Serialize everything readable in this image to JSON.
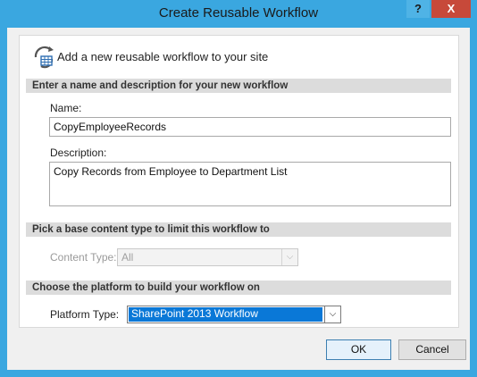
{
  "window": {
    "title": "Create Reusable Workflow",
    "help_glyph": "?",
    "close_glyph": "X"
  },
  "header": {
    "icon": "workflow-icon",
    "text": "Add a new reusable workflow to your site"
  },
  "sections": {
    "name_section": "Enter a name and description for your new workflow",
    "content_section": "Pick a base content type to limit this workflow to",
    "platform_section": "Choose the platform to build your workflow on"
  },
  "fields": {
    "name_label": "Name:",
    "name_value": "CopyEmployeeRecords",
    "description_label": "Description:",
    "description_value": "Copy Records from Employee to Department List",
    "content_type_label": "Content Type:",
    "content_type_value": "All",
    "platform_type_label": "Platform Type:",
    "platform_type_value": "SharePoint 2013 Workflow"
  },
  "buttons": {
    "ok": "OK",
    "cancel": "Cancel"
  },
  "colors": {
    "frame": "#3aa7e0",
    "close": "#c7493a",
    "selection": "#0a78d7"
  }
}
